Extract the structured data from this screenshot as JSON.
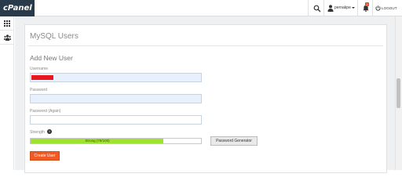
{
  "topbar": {
    "logo": "cPanel",
    "username": "pernakpe",
    "notification_count": "2",
    "logout_label": "LOGOUT"
  },
  "page": {
    "title": "MySQL Users",
    "section_title": "Add New User"
  },
  "form": {
    "username_label": "Username",
    "password_label": "Password",
    "password_again_label": "Password (Again)",
    "strength_label": "Strength",
    "strength_text": "Strong (78/100)",
    "strength_value": 78,
    "strength_max": 100,
    "password_generator_label": "Password Generator",
    "create_button_label": "Create User"
  },
  "colors": {
    "logo_bg": "#293a4a",
    "strength_fill": "#9fe42c",
    "create_button": "#f15a22",
    "redaction": "#e8171f"
  },
  "icons": {
    "search": "search-icon",
    "user": "user-icon",
    "bell": "bell-icon",
    "logout": "logout-icon",
    "apps": "grid-icon",
    "users": "users-icon",
    "info": "info-icon"
  }
}
